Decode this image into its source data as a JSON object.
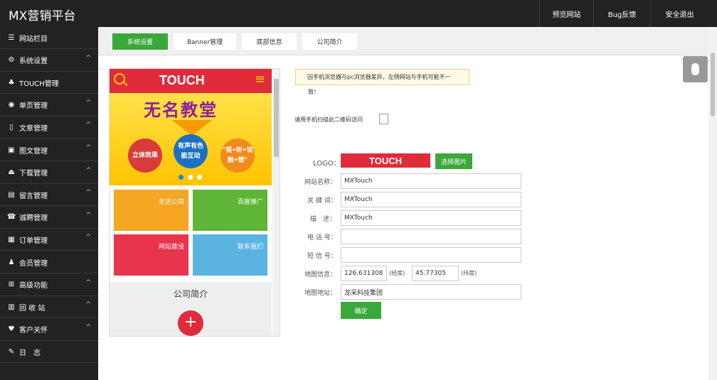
{
  "header": {
    "brand": "MX营销平台",
    "nav": [
      {
        "label": "预览网站"
      },
      {
        "label": "Bug反馈"
      },
      {
        "label": "安全退出"
      }
    ]
  },
  "sidebar": {
    "items": [
      {
        "label": "网站栏目",
        "icon": "list-icon",
        "glyph": "☰",
        "has_caret": false
      },
      {
        "label": "系统设置",
        "icon": "gear-icon",
        "glyph": "⚙",
        "has_caret": true
      },
      {
        "label": "TOUCH管理",
        "icon": "android-icon",
        "glyph": "♣",
        "has_caret": false
      },
      {
        "label": "单页管理",
        "icon": "page-icon",
        "glyph": "◉",
        "has_caret": true
      },
      {
        "label": "文章管理",
        "icon": "file-icon",
        "glyph": "▯",
        "has_caret": true
      },
      {
        "label": "图文管理",
        "icon": "image-icon",
        "glyph": "▣",
        "has_caret": true
      },
      {
        "label": "下载管理",
        "icon": "download-icon",
        "glyph": "⏏",
        "has_caret": true
      },
      {
        "label": "留言管理",
        "icon": "message-icon",
        "glyph": "▤",
        "has_caret": true
      },
      {
        "label": "诚聘管理",
        "icon": "phone-icon",
        "glyph": "☎",
        "has_caret": true
      },
      {
        "label": "订单管理",
        "icon": "briefcase-icon",
        "glyph": "▦",
        "has_caret": true
      },
      {
        "label": "会员管理",
        "icon": "user-icon",
        "glyph": "♟",
        "has_caret": false
      },
      {
        "label": "高级功能",
        "icon": "windows-icon",
        "glyph": "⊞",
        "has_caret": true
      },
      {
        "label": "回 收 站",
        "icon": "trash-icon",
        "glyph": "▥",
        "has_caret": true
      },
      {
        "label": "客户关怀",
        "icon": "heart-icon",
        "glyph": "♥",
        "has_caret": true
      },
      {
        "label": "日　志",
        "icon": "pencil-icon",
        "glyph": "✎",
        "has_caret": false
      }
    ],
    "caret_glyph": "^"
  },
  "tabs": [
    {
      "label": "系统设置",
      "active": true
    },
    {
      "label": "Banner管理",
      "active": false
    },
    {
      "label": "底部信息",
      "active": false
    },
    {
      "label": "公司简介",
      "active": false
    }
  ],
  "preview": {
    "header_logo": "TOUCH",
    "menu_glyph": "≡",
    "search_glyph": "○",
    "banner_title": "无名教堂",
    "banner_circles": [
      "立体效果",
      "有声有色 能互动",
      "\"视•听•说 触•想\""
    ],
    "tiles": [
      "走进公司",
      "百度推广",
      "网站建设",
      "联系我们"
    ],
    "about_title": "公司简介",
    "about_plus": "+",
    "colors": {
      "header": "#e02b3b",
      "banner": "#ffc400",
      "tile1": "#f5a623",
      "tile2": "#5fb536",
      "tile3": "#e8354d",
      "tile4": "#5ab3e0"
    }
  },
  "notice": {
    "line1": "因手机浏览器与pc浏览器差异，左侧网站与手机可能不一",
    "line2": "致！"
  },
  "qr_label": "请用手机扫描此二维码访问",
  "form": {
    "logo_label": "LOGO：",
    "logo_preview_text": "TOUCH",
    "choose_image": "选择图片",
    "site_name_label": "网站名称：",
    "site_name_value": "MXTouch",
    "keywords_label": "关 键 词：",
    "keywords_value": "MXTouch",
    "description_label": "描　述：",
    "description_value": "MXTouch",
    "phone_label": "电 话 号：",
    "phone_value": "",
    "sms_label": "短 信 号：",
    "sms_value": "",
    "map_info_label": "地图信息：",
    "longitude_value": "126.631308",
    "longitude_suffix": "(经度)",
    "latitude_value": "45.77305",
    "latitude_suffix": "(纬度)",
    "map_address_label": "地图地址：",
    "map_address_value": "龙采科技集团",
    "submit": "确定"
  },
  "colors": {
    "accent": "#3aa83a",
    "sidebar": "#222222",
    "brand_red": "#e02b3b"
  }
}
